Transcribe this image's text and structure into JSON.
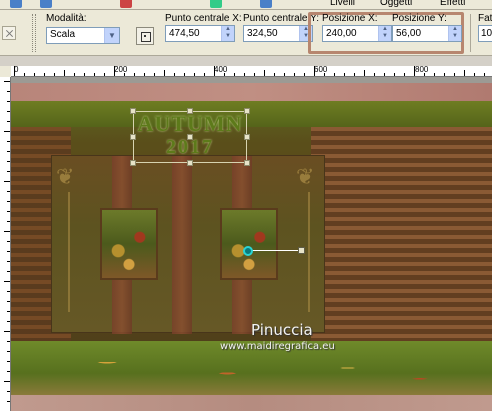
{
  "menu": {
    "item1": "Livelli",
    "item2": "Oggetti",
    "item3": "Effetti"
  },
  "tool_options": {
    "mode_label": "Modalità:",
    "mode_value": "Scala",
    "center_x_label": "Punto centrale X:",
    "center_x_value": "474,50",
    "center_y_label": "Punto centrale Y:",
    "center_y_value": "324,50",
    "pos_x_label": "Posizione X:",
    "pos_x_value": "240,00",
    "pos_y_label": "Posizione Y:",
    "pos_y_value": "56,00",
    "cut_label": "Fat",
    "cut_value": "10"
  },
  "ruler": {
    "marks": [
      "0",
      "200",
      "400",
      "600",
      "800"
    ]
  },
  "canvas": {
    "title_line1": "AUTUMN",
    "title_line2": "2017",
    "watermark": "Pinuccia",
    "watermark_url": "www.maidiregrafica.eu"
  },
  "colors": {
    "highlight_border": "#b7866f",
    "title_text": "#5d7a1a",
    "rotation_center": "#2ad3d3"
  }
}
